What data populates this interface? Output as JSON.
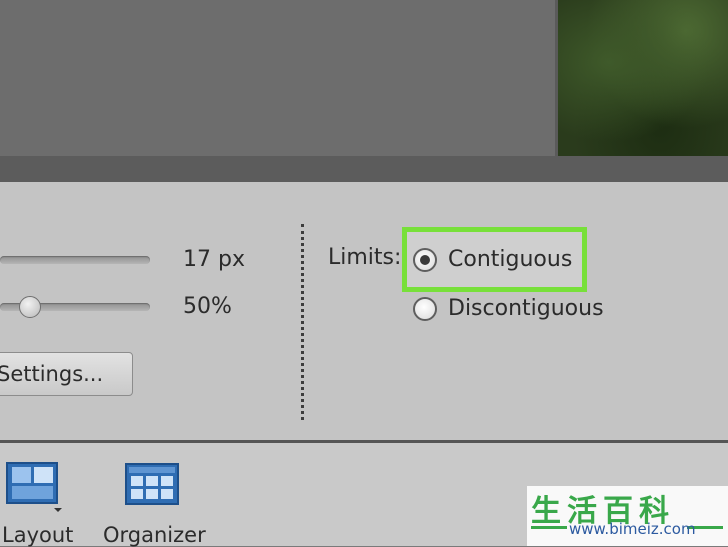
{
  "options_panel": {
    "size_value": "17 px",
    "tolerance_value": "50%",
    "tolerance_level_percent": 50,
    "settings_button_label": "Settings...",
    "limits_label": "Limits:",
    "radio_options": [
      {
        "label": "Contiguous",
        "selected": true
      },
      {
        "label": "Discontiguous",
        "selected": false
      }
    ],
    "highlight_color": "#78e03a"
  },
  "bottom_bar": {
    "items": [
      {
        "label": "Layout",
        "icon": "layout-icon"
      },
      {
        "label": "Organizer",
        "icon": "organizer-icon"
      }
    ]
  },
  "watermark": {
    "chars": "生活百科",
    "url": "www.bimeiz.com"
  },
  "colors": {
    "panel_bg": "#c4c4c4",
    "icon_blue": "#2f6db3"
  }
}
